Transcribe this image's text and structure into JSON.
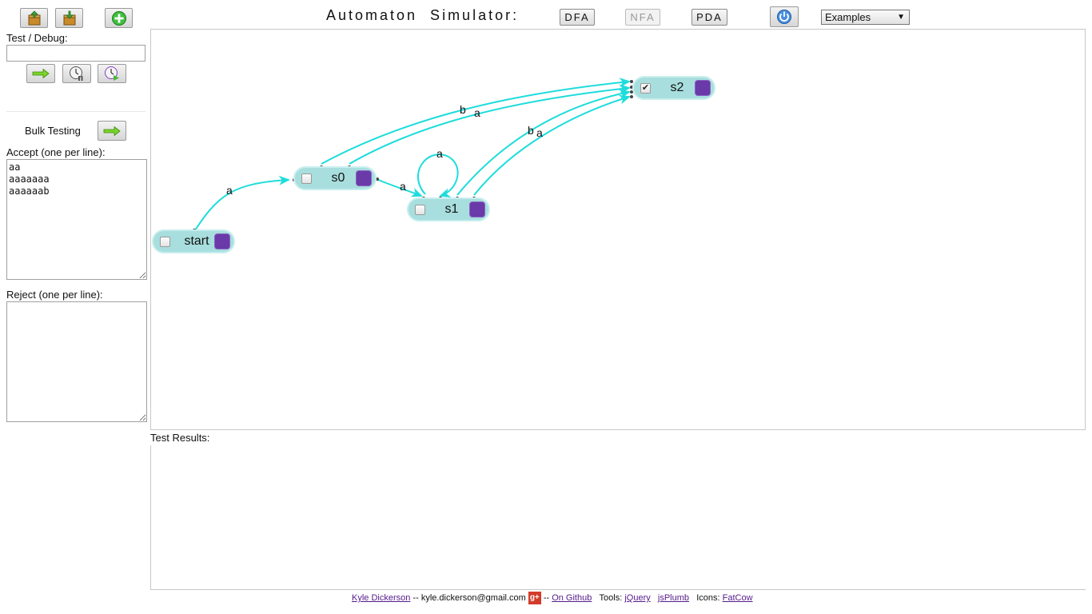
{
  "header": {
    "title": "Automaton  Simulator:",
    "modes": [
      "DFA",
      "NFA",
      "PDA"
    ],
    "examples_label": "Examples"
  },
  "sidebar": {
    "test_debug_label": "Test / Debug:",
    "test_input_value": "",
    "bulk_testing_label": "Bulk Testing",
    "accept_label": "Accept (one per line):",
    "accept_value": "aa\naaaaaaa\naaaaaab",
    "reject_label": "Reject (one per line):",
    "reject_value": ""
  },
  "diagram": {
    "states": [
      {
        "id": "start",
        "label": "start",
        "accepting": false
      },
      {
        "id": "s0",
        "label": "s0",
        "accepting": false
      },
      {
        "id": "s1",
        "label": "s1",
        "accepting": false
      },
      {
        "id": "s2",
        "label": "s2",
        "accepting": true
      }
    ],
    "transitions": [
      {
        "from": "start",
        "to": "s0",
        "label": "a"
      },
      {
        "from": "s0",
        "to": "s1",
        "label": "a"
      },
      {
        "from": "s0",
        "to": "s2",
        "label": "b"
      },
      {
        "from": "s0",
        "to": "s2",
        "label": "a"
      },
      {
        "from": "s1",
        "to": "s1",
        "label": "a"
      },
      {
        "from": "s1",
        "to": "s2",
        "label": "b"
      },
      {
        "from": "s1",
        "to": "s2",
        "label": "a"
      }
    ],
    "edge_color": "#1fdcdc",
    "state_color": "#a8dede",
    "handle_color": "#6a3aa8"
  },
  "results": {
    "label": "Test Results:"
  },
  "footer": {
    "author_link": "Kyle Dickerson",
    "sep1": "--",
    "email": "kyle.dickerson@gmail.com",
    "gplus": "g+",
    "sep2": "--",
    "github_link": "On Github",
    "tools_label": "Tools:",
    "tool1": "jQuery",
    "tool2": "jsPlumb",
    "icons_label": "Icons:",
    "icons_link": "FatCow"
  }
}
